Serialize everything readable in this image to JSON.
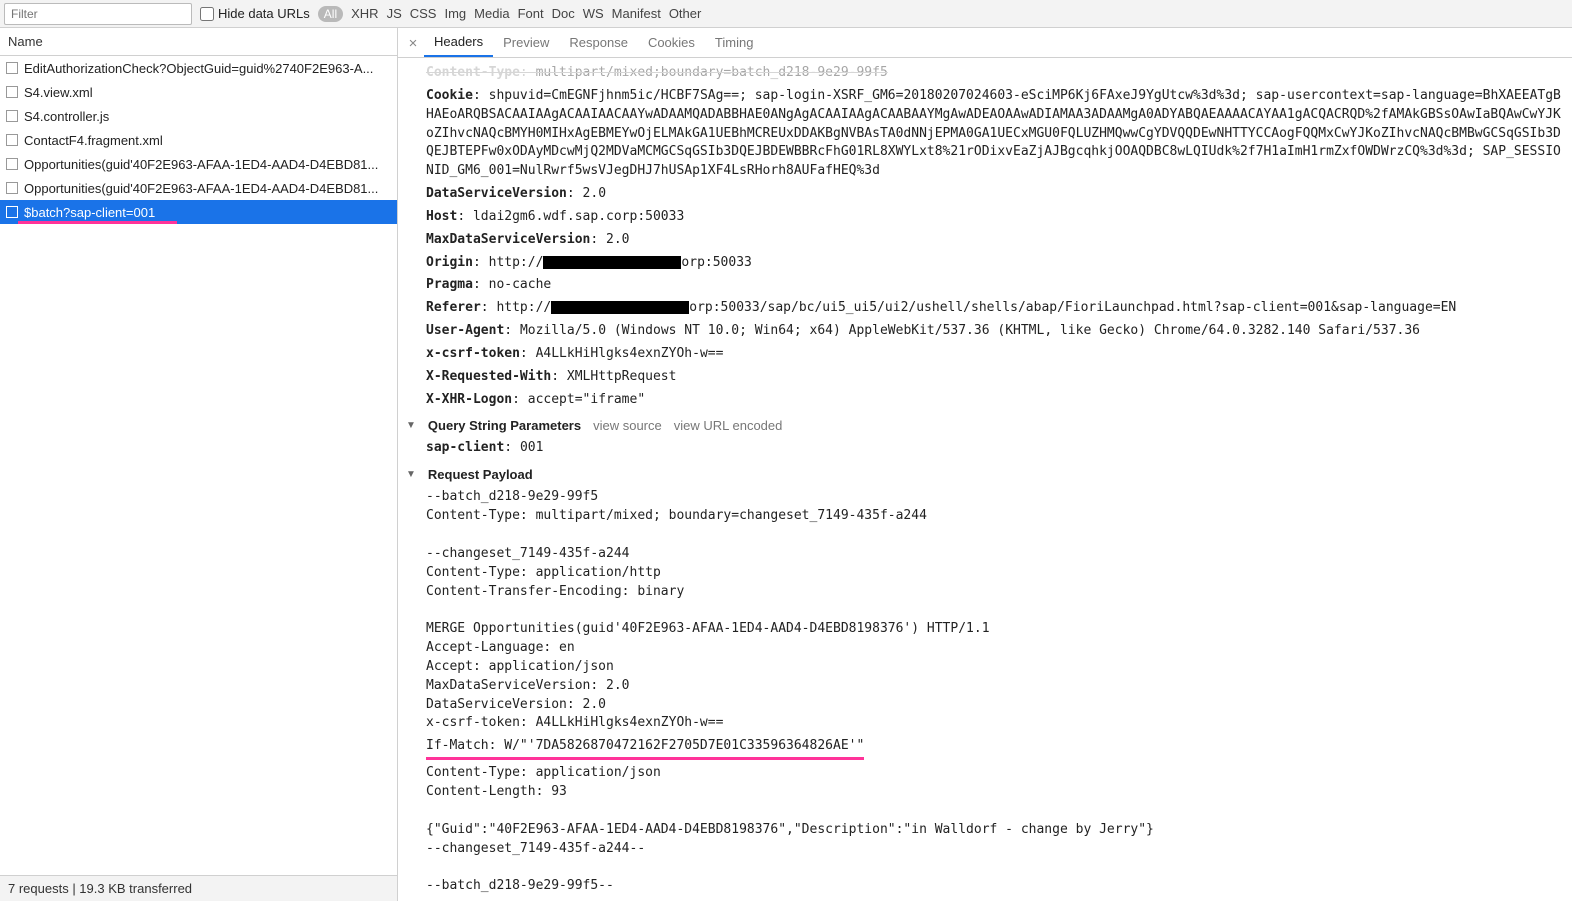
{
  "toolbar": {
    "filter_placeholder": "Filter",
    "hide_urls_label": "Hide data URLs",
    "categories": [
      "All",
      "XHR",
      "JS",
      "CSS",
      "Img",
      "Media",
      "Font",
      "Doc",
      "WS",
      "Manifest",
      "Other"
    ],
    "active_category": "All"
  },
  "left": {
    "column_header": "Name",
    "requests": [
      {
        "name": "EditAuthorizationCheck?ObjectGuid=guid%2740F2E963-A...",
        "selected": false
      },
      {
        "name": "S4.view.xml",
        "selected": false
      },
      {
        "name": "S4.controller.js",
        "selected": false
      },
      {
        "name": "ContactF4.fragment.xml",
        "selected": false
      },
      {
        "name": "Opportunities(guid'40F2E963-AFAA-1ED4-AAD4-D4EBD81...",
        "selected": false
      },
      {
        "name": "Opportunities(guid'40F2E963-AFAA-1ED4-AAD4-D4EBD81...",
        "selected": false
      },
      {
        "name": "$batch?sap-client=001",
        "selected": true
      }
    ]
  },
  "status_bar": "7 requests | 19.3 KB transferred",
  "right": {
    "tabs": [
      "Headers",
      "Preview",
      "Response",
      "Cookies",
      "Timing"
    ],
    "active_tab": "Headers",
    "headers_top_fragment": {
      "content_type_partial": "multipart/mixed;boundary=batch_d218-9e29-99f5"
    },
    "headers": [
      {
        "k": "Cookie",
        "v": "shpuvid=CmEGNFjhnm5ic/HCBF7SAg==; sap-login-XSRF_GM6=20180207024603-eSciMP6Kj6FAxeJ9YgUtcw%3d%3d; sap-usercontext=sap-language=BhXAEEATgBHAEoARQBSACAAIAAgACAAIAACAAYwADAAMQADABBHAE0ANgAgACAAIAAgACAABAAYMgAwADEAOAAwADIAMAA3ADAAMgA0ADYABQAEAAAACAYAA1gACQACRQD%2fAMAkGBSsOAwIaBQAwCwYJKoZIhvcNAQcBMYH0MIHxAgEBMEYwOjELMAkGA1UEBhMCREUxDDAKBgNVBAsTA0dNNjEPMA0GA1UECxMGU0FQLUZHMQwwCgYDVQQDEwNHTTYCCAogFQQMxCwYJKoZIhvcNAQcBMBwGCSqGSIb3DQEJBTEPFw0xODAyMDcwMjQ2MDVaMCMGCSqGSIb3DQEJBDEWBBRcFhG01RL8XWYLxt8%21rODixvEaZjAJBgcqhkjOOAQDBC8wLQIUdk%2f7H1aImH1rmZxfOWDWrzCQ%3d%3d; SAP_SESSIONID_GM6_001=NulRwrf5wsVJegDHJ7hUSAp1XF4LsRHorh8AUFafHEQ%3d",
        "wrap": true
      },
      {
        "k": "DataServiceVersion",
        "v": "2.0"
      },
      {
        "k": "Host",
        "v": "ldai2gm6.wdf.sap.corp:50033"
      },
      {
        "k": "MaxDataServiceVersion",
        "v": "2.0"
      },
      {
        "k": "Origin",
        "v": "http://",
        "redact_w": 138,
        "v2": "orp:50033"
      },
      {
        "k": "Pragma",
        "v": "no-cache"
      },
      {
        "k": "Referer",
        "v": "http://",
        "redact_w": 138,
        "v2": "orp:50033/sap/bc/ui5_ui5/ui2/ushell/shells/abap/FioriLaunchpad.html?sap-client=001&sap-language=EN"
      },
      {
        "k": "User-Agent",
        "v": "Mozilla/5.0 (Windows NT 10.0; Win64; x64) AppleWebKit/537.36 (KHTML, like Gecko) Chrome/64.0.3282.140 Safari/537.36"
      },
      {
        "k": "x-csrf-token",
        "v": "A4LLkHiHlgks4exnZYOh-w=="
      },
      {
        "k": "X-Requested-With",
        "v": "XMLHttpRequest"
      },
      {
        "k": "X-XHR-Logon",
        "v": "accept=\"iframe\""
      }
    ],
    "query_section": {
      "title": "Query String Parameters",
      "view_source": "view source",
      "view_url_encoded": "view URL encoded",
      "params": [
        {
          "k": "sap-client",
          "v": "001"
        }
      ]
    },
    "payload_section": {
      "title": "Request Payload",
      "lines_before_ifmatch": "--batch_d218-9e29-99f5\nContent-Type: multipart/mixed; boundary=changeset_7149-435f-a244\n\n--changeset_7149-435f-a244\nContent-Type: application/http\nContent-Transfer-Encoding: binary\n\nMERGE Opportunities(guid'40F2E963-AFAA-1ED4-AAD4-D4EBD8198376') HTTP/1.1\nAccept-Language: en\nAccept: application/json\nMaxDataServiceVersion: 2.0\nDataServiceVersion: 2.0\nx-csrf-token: A4LLkHiHlgks4exnZYOh-w==",
      "ifmatch_line": "If-Match: W/\"'7DA5826870472162F2705D7E01C33596364826AE'\"",
      "lines_after_ifmatch": "Content-Type: application/json\nContent-Length: 93\n\n{\"Guid\":\"40F2E963-AFAA-1ED4-AAD4-D4EBD8198376\",\"Description\":\"in Walldorf - change by Jerry\"}\n--changeset_7149-435f-a244--\n\n--batch_d218-9e29-99f5--"
    }
  }
}
